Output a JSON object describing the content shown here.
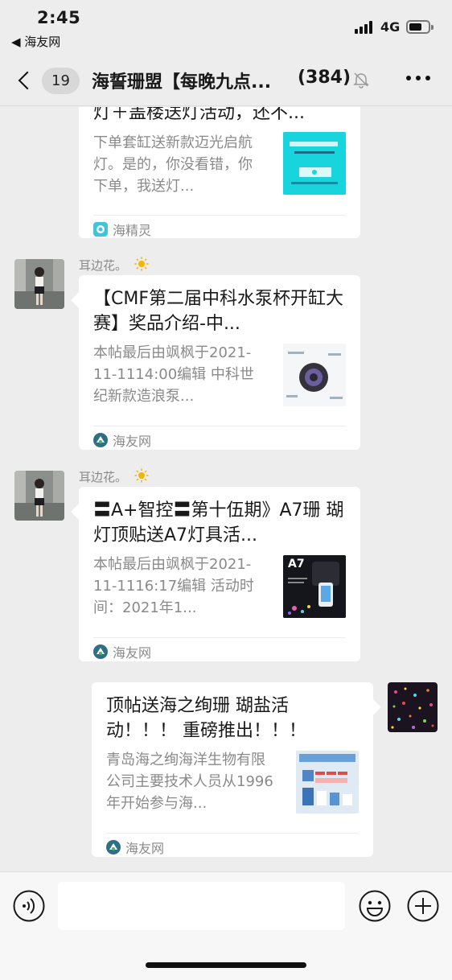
{
  "status_bar": {
    "time": "2:45",
    "back_app": "◀ 海友网",
    "network": "4G"
  },
  "nav": {
    "unread_count": "19",
    "chat_title": "海誓珊盟【每晚九点...",
    "member_count": "(384)"
  },
  "messages": [
    {
      "title": "灯＋盖楼送灯活动，还不...",
      "desc": "下单套缸送新款迈光启航灯。是的，你没看错，你下单，我送灯...",
      "source": "海精灵"
    },
    {
      "sender": "耳边花。",
      "title": "【CMF第二届中科水泵杯开缸大赛】奖品介绍-中...",
      "desc": "本帖最后由飒枫于2021-11-1114:00编辑 中科世纪新款造浪泵...",
      "source": "海友网"
    },
    {
      "sender": "耳边花。",
      "title": "〓A+智控〓第十伍期》A7珊 瑚灯顶贴送A7灯具活...",
      "desc": "本帖最后由飒枫于2021-11-1116:17编辑 活动时间：2021年1...",
      "thumb_label": "A7",
      "source": "海友网"
    },
    {
      "title": "顶帖送海之绚珊 瑚盐活动！！！ 重磅推出！！！",
      "desc": "青岛海之绚海洋生物有限公司主要技术人员从1996年开始参与海...",
      "source": "海友网"
    }
  ],
  "colors": {
    "background": "#ededed",
    "card": "#ffffff",
    "secondary_text": "#8a8a8a",
    "accent_cyan": "#18d4dc"
  },
  "icons": [
    "back-chevron-icon",
    "mute-bell-icon",
    "more-icon",
    "voice-icon",
    "emoji-icon",
    "plus-icon",
    "sun-icon",
    "haijingling-icon",
    "haiyouwang-icon"
  ]
}
